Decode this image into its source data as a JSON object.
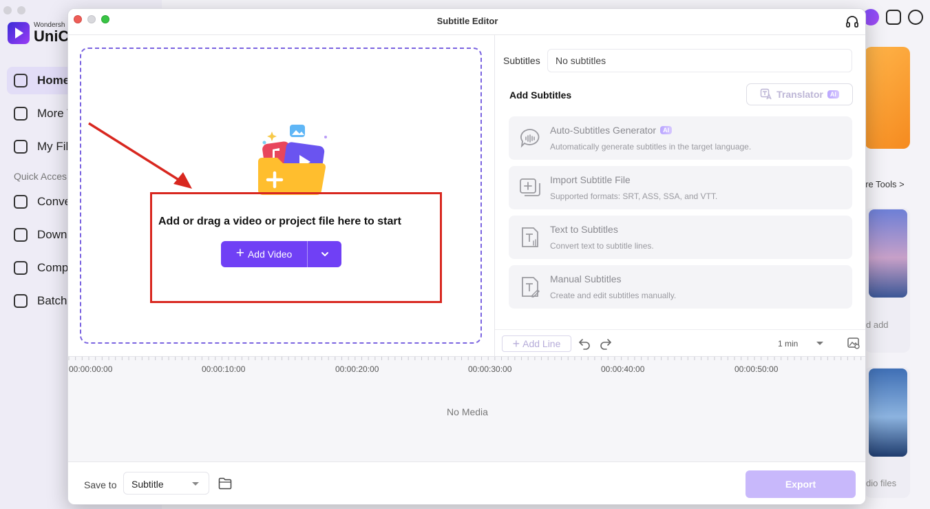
{
  "background_app": {
    "brand_small": "Wondersh",
    "brand_large": "UniCo",
    "nav": [
      {
        "label": "Home",
        "active": true
      },
      {
        "label": "More T",
        "active": false
      },
      {
        "label": "My Fil",
        "active": false
      }
    ],
    "quick_access_label": "Quick Acces",
    "quick_items": [
      "Conve",
      "Downl",
      "Comp",
      "Batch"
    ],
    "right_texts": {
      "more_tools": "ore Tools >",
      "add": "d add",
      "audio_files": "dio files"
    }
  },
  "window": {
    "title": "Subtitle Editor"
  },
  "dropzone": {
    "prompt": "Add or drag a video or project file here to start",
    "add_video_label": "Add Video"
  },
  "subtitles_panel": {
    "subtitles_label": "Subtitles",
    "subtitles_value": "No subtitles",
    "add_subtitles_title": "Add Subtitles",
    "translator_label": "Translator",
    "ai_badge": "AI",
    "options": [
      {
        "title": "Auto-Subtitles Generator",
        "desc": "Automatically generate subtitles in the target language.",
        "icon": "speech-bubble-icon",
        "ai": true
      },
      {
        "title": "Import Subtitle File",
        "desc": "Supported formats: SRT, ASS, SSA, and VTT.",
        "icon": "import-subtitle-icon",
        "ai": false
      },
      {
        "title": "Text to Subtitles",
        "desc": "Convert text to subtitle lines.",
        "icon": "text-to-subtitle-icon",
        "ai": false
      },
      {
        "title": "Manual Subtitles",
        "desc": "Create and edit subtitles manually.",
        "icon": "manual-subtitle-icon",
        "ai": false
      }
    ],
    "add_line_label": "Add Line",
    "zoom_value": "1 min"
  },
  "timeline": {
    "ticks": [
      "00:00:00:00",
      "00:00:10:00",
      "00:00:20:00",
      "00:00:30:00",
      "00:00:40:00",
      "00:00:50:00"
    ],
    "empty_text": "No Media"
  },
  "footer": {
    "save_to_label": "Save to",
    "save_to_value": "Subtitle",
    "export_label": "Export"
  },
  "colors": {
    "accent": "#7040f5",
    "annotation_red": "#d8271f",
    "export_disabled": "#c8b8fb"
  }
}
